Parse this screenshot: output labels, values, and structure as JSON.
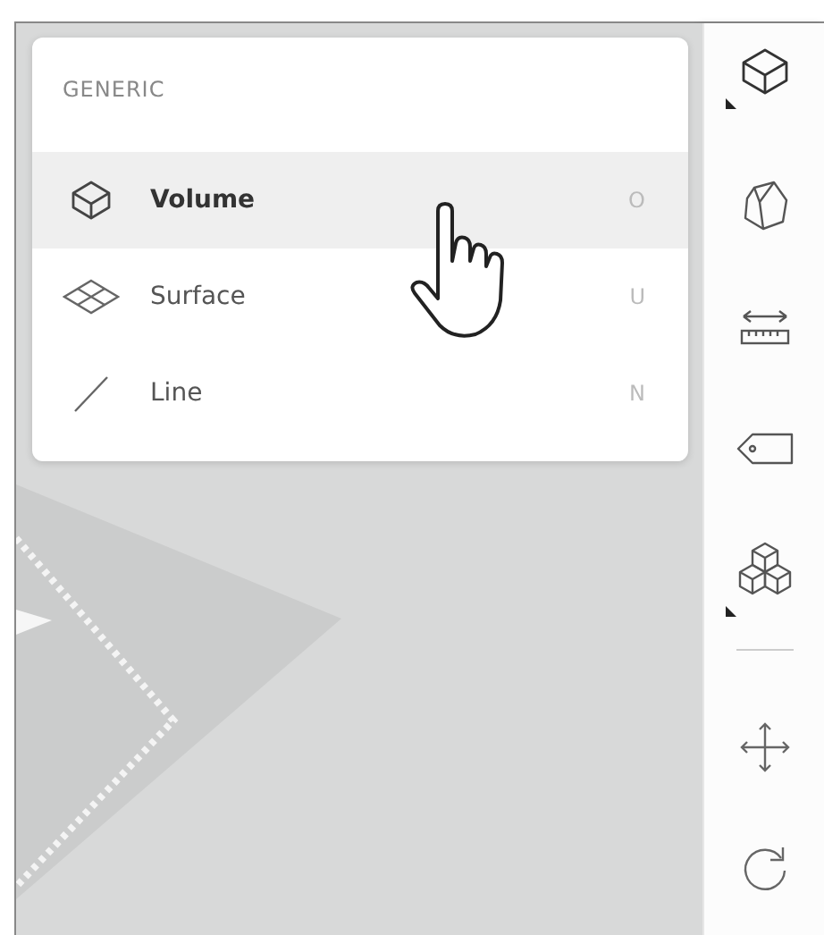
{
  "menu": {
    "heading": "GENERIC",
    "items": [
      {
        "kind": "volume",
        "label": "Volume",
        "shortcut": "O",
        "selected": true
      },
      {
        "kind": "surface",
        "label": "Surface",
        "shortcut": "U",
        "selected": false
      },
      {
        "kind": "line",
        "label": "Line",
        "shortcut": "N",
        "selected": false
      }
    ]
  },
  "toolbar": {
    "tools": [
      {
        "kind": "box",
        "submenu": true
      },
      {
        "kind": "prism"
      },
      {
        "kind": "measure"
      },
      {
        "kind": "tag"
      },
      {
        "kind": "cubes",
        "submenu": true
      },
      {
        "kind": "divider"
      },
      {
        "kind": "move"
      },
      {
        "kind": "rotate"
      }
    ]
  }
}
